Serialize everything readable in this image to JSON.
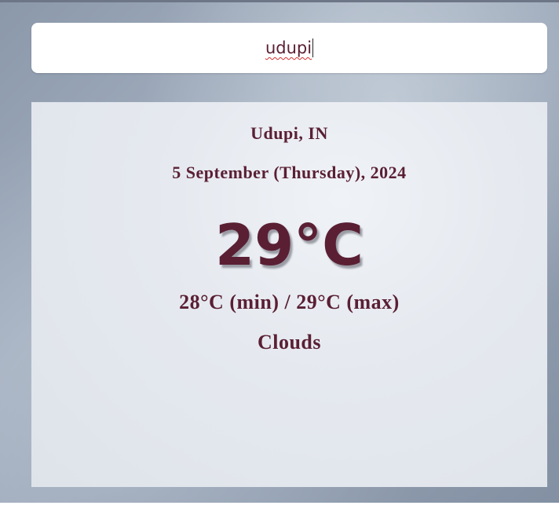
{
  "search": {
    "value": "udupi",
    "placeholder": ""
  },
  "weather": {
    "location": "Udupi, IN",
    "date": "5 September (Thursday), 2024",
    "temperature": "29°C",
    "min_max": "28°C (min) / 29°C (max)",
    "condition": "Clouds"
  },
  "colors": {
    "text": "#5a1f33",
    "card_background": "#e1e5eb",
    "search_background": "#ffffff"
  }
}
